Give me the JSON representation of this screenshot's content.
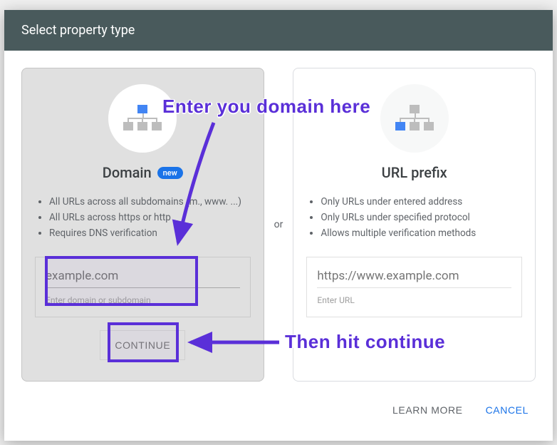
{
  "header": {
    "title": "Select property type"
  },
  "separator": "or",
  "domain_card": {
    "title": "Domain",
    "badge": "new",
    "bullets": [
      "All URLs across all subdomains (m., www. ...)",
      "All URLs across https or http",
      "Requires DNS verification"
    ],
    "input_placeholder": "example.com",
    "input_hint": "Enter domain or subdomain",
    "continue": "Continue"
  },
  "urlprefix_card": {
    "title": "URL prefix",
    "bullets": [
      "Only URLs under entered address",
      "Only URLs under specified protocol",
      "Allows multiple verification methods"
    ],
    "input_placeholder": "https://www.example.com",
    "input_hint": "Enter URL"
  },
  "footer": {
    "learn_more": "Learn More",
    "cancel": "Cancel"
  },
  "annotations": {
    "domain_hint": "Enter you domain here",
    "continue_hint": "Then hit continue"
  }
}
